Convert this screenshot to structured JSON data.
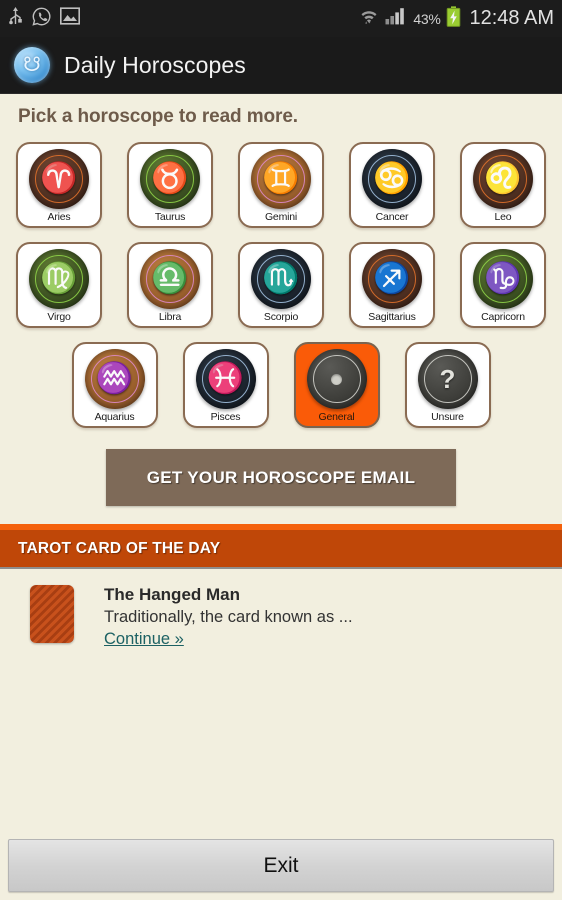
{
  "status_bar": {
    "left_icons": [
      "usb-icon",
      "whatsapp-icon",
      "photo-icon"
    ],
    "wifi_icon": "wifi-icon",
    "signal_icon": "signal-bars-icon",
    "battery_percent": "43%",
    "battery_icon": "battery-charging-icon",
    "clock": "12:48 AM"
  },
  "action_bar": {
    "app_icon": "daily-horoscopes-app-icon",
    "title": "Daily Horoscopes"
  },
  "main": {
    "prompt": "Pick a horoscope to read more.",
    "tiles": [
      {
        "label": "Aries",
        "glyph": "♈",
        "element": "fire",
        "selected": false
      },
      {
        "label": "Taurus",
        "glyph": "♉",
        "element": "earth",
        "selected": false
      },
      {
        "label": "Gemini",
        "glyph": "♊",
        "element": "air",
        "selected": false
      },
      {
        "label": "Cancer",
        "glyph": "♋",
        "element": "water",
        "selected": false
      },
      {
        "label": "Leo",
        "glyph": "♌",
        "element": "fire",
        "selected": false
      },
      {
        "label": "Virgo",
        "glyph": "♍",
        "element": "earth",
        "selected": false
      },
      {
        "label": "Libra",
        "glyph": "♎",
        "element": "air",
        "selected": false
      },
      {
        "label": "Scorpio",
        "glyph": "♏",
        "element": "water",
        "selected": false
      },
      {
        "label": "Sagittarius",
        "glyph": "♐",
        "element": "fire",
        "selected": false
      },
      {
        "label": "Capricorn",
        "glyph": "♑",
        "element": "earth",
        "selected": false
      },
      {
        "label": "Aquarius",
        "glyph": "♒",
        "element": "air",
        "selected": false
      },
      {
        "label": "Pisces",
        "glyph": "♓",
        "element": "water",
        "selected": false
      },
      {
        "label": "General",
        "glyph": "",
        "element": "stone",
        "selected": true,
        "icon": "disc-icon"
      },
      {
        "label": "Unsure",
        "glyph": "?",
        "element": "stone",
        "selected": false,
        "icon": "question-mark-icon"
      }
    ],
    "email_button": "GET YOUR HOROSCOPE EMAIL"
  },
  "tarot": {
    "header": "TAROT CARD OF THE DAY",
    "card_thumb": "tarot-card-back-icon",
    "card_title": "The Hanged Man",
    "card_excerpt": "Traditionally, the card known as ...",
    "continue_link": "Continue »"
  },
  "footer": {
    "exit_button": "Exit"
  },
  "colors": {
    "background": "#F2EFDF",
    "action_bar": "#1A1A1A",
    "tarot_header": "#BF4708",
    "tarot_accent": "#F4610C",
    "email_button": "#7E6A58",
    "selected_tile": "#FA5B08",
    "link": "#1C6163",
    "prompt_text": "#6E5B4A"
  }
}
